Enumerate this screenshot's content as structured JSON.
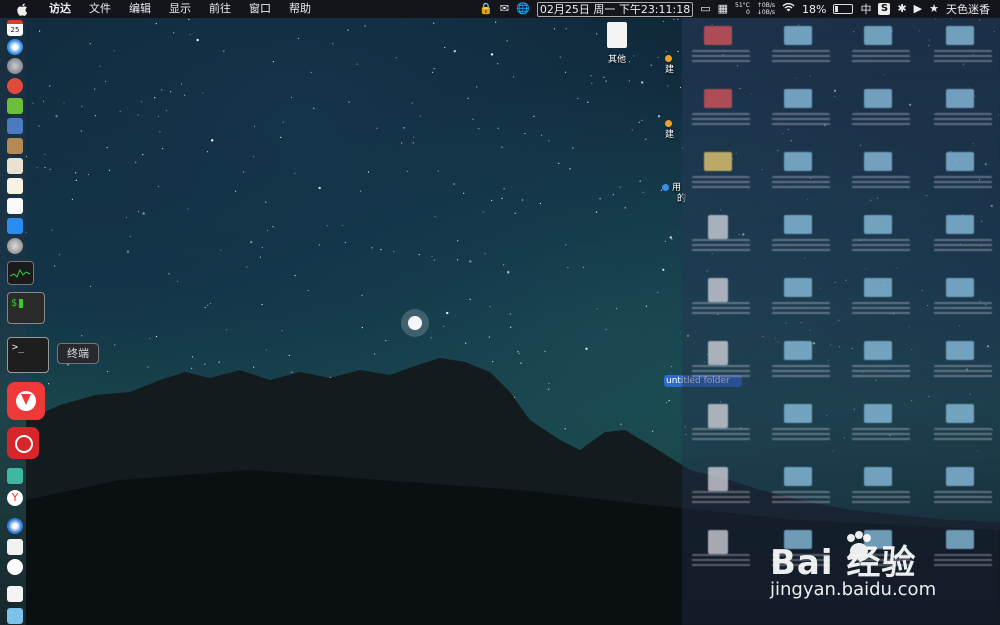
{
  "menubar": {
    "apple_icon": "apple-icon",
    "app_name": "访达",
    "items": [
      "文件",
      "编辑",
      "显示",
      "前往",
      "窗口",
      "帮助"
    ]
  },
  "status": {
    "lock_icon": "lock-icon",
    "datetime": "02月25日 周一 下午23:11:18",
    "temperature": "51°C",
    "temp_sub": "0",
    "net_up": "0B/s",
    "net_down": "0B/s",
    "battery": "18%",
    "input_method": "中",
    "s_badge": "S",
    "user_name": "天色迷香"
  },
  "dock": {
    "calendar_day": "25",
    "terminal_tooltip": "终端",
    "terminal_prompt": ">_",
    "shell_prompt": "$"
  },
  "desktop": {
    "other_file_label": "其他",
    "left_labels": [
      "建",
      "建",
      "用",
      "的"
    ],
    "selected_label": "untitled folder"
  },
  "watermark": {
    "brand": "Bai  经验",
    "url": "jingyan.baidu.com"
  },
  "colors": {
    "selection": "#2f6ad0",
    "folder": "#8fc6e6",
    "menubar": "#141418"
  }
}
